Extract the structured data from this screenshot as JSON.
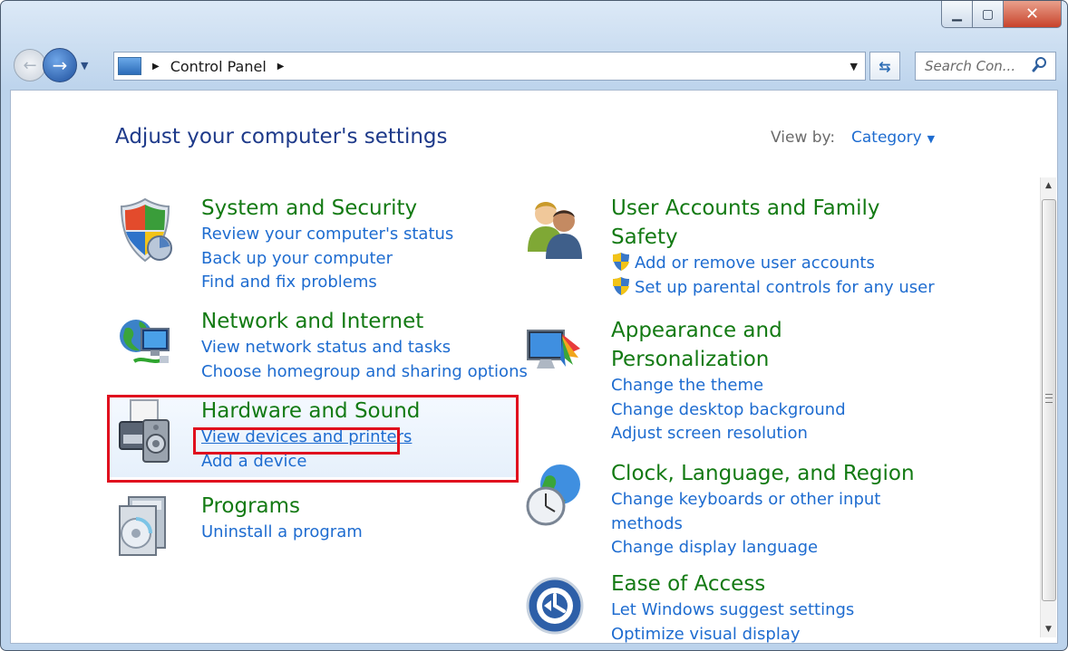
{
  "window": {
    "controls": {
      "minimize": "▁",
      "maximize": "▢",
      "close": "✕"
    }
  },
  "nav": {
    "back": "←",
    "forward": "→",
    "history_drop": "▼"
  },
  "address": {
    "crumb": "Control Panel",
    "drop": "▼"
  },
  "search": {
    "placeholder": "Search Con..."
  },
  "page": {
    "title": "Adjust your computer's settings",
    "view_by_label": "View by:",
    "view_by_value": "Category"
  },
  "categories": [
    {
      "title": [
        "System and Security"
      ],
      "links": [
        "Review your computer's status",
        "Back up your computer",
        "Find and fix problems"
      ],
      "icon": "shield-icon"
    },
    {
      "title": [
        "Network and Internet"
      ],
      "links": [
        "View network status and tasks",
        "Choose homegroup and sharing options"
      ],
      "icon": "network-icon"
    },
    {
      "title": [
        "Hardware and Sound"
      ],
      "links": [
        "View devices and printers",
        "Add a device"
      ],
      "icon": "printer-icon"
    },
    {
      "title": [
        "Programs"
      ],
      "links": [
        "Uninstall a program"
      ],
      "icon": "programs-icon"
    },
    {
      "title": [
        "User Accounts and Family",
        "Safety"
      ],
      "links": [
        "Add or remove user accounts",
        "Set up parental controls for any user"
      ],
      "icon": "users-icon"
    },
    {
      "title": [
        "Appearance and",
        "Personalization"
      ],
      "links": [
        "Change the theme",
        "Change desktop background",
        "Adjust screen resolution"
      ],
      "icon": "monitor-icon"
    },
    {
      "title": [
        "Clock, Language, and Region"
      ],
      "links": [
        "Change keyboards or other input",
        "methods",
        "Change display language"
      ],
      "icon": "clock-globe-icon"
    },
    {
      "title": [
        "Ease of Access"
      ],
      "links": [
        "Let Windows suggest settings",
        "Optimize visual display"
      ],
      "icon": "ease-of-access-icon"
    }
  ],
  "colors": {
    "link": "#1e6cd0",
    "category_title": "#137a13",
    "highlight": "#e0101e",
    "heading": "#1e3a8a"
  }
}
